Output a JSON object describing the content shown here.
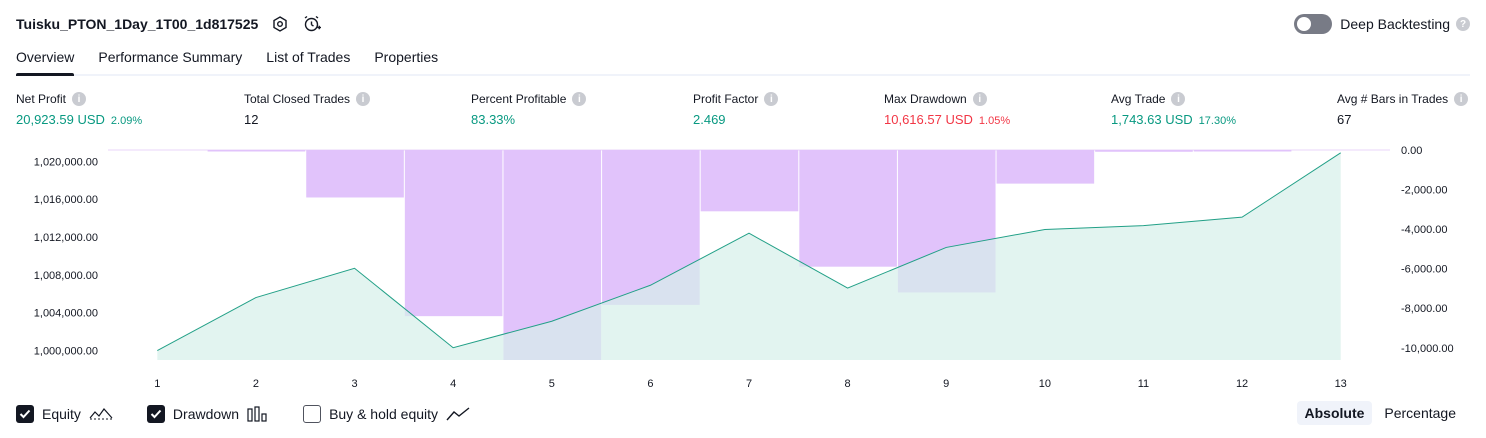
{
  "header": {
    "title": "Tuisku_PTON_1Day_1T00_1d817525",
    "deep_backtesting_label": "Deep Backtesting"
  },
  "tabs": [
    {
      "label": "Overview"
    },
    {
      "label": "Performance Summary"
    },
    {
      "label": "List of Trades"
    },
    {
      "label": "Properties"
    }
  ],
  "metrics": [
    {
      "label": "Net Profit",
      "value": "20,923.59 USD",
      "sub": "2.09%"
    },
    {
      "label": "Total Closed Trades",
      "value": "12",
      "sub": ""
    },
    {
      "label": "Percent Profitable",
      "value": "83.33%",
      "sub": ""
    },
    {
      "label": "Profit Factor",
      "value": "2.469",
      "sub": ""
    },
    {
      "label": "Max Drawdown",
      "value": "10,616.57 USD",
      "sub": "1.05%"
    },
    {
      "label": "Avg Trade",
      "value": "1,743.63 USD",
      "sub": "17.30%"
    },
    {
      "label": "Avg # Bars in Trades",
      "value": "67",
      "sub": ""
    }
  ],
  "legend": {
    "equity_label": "Equity",
    "drawdown_label": "Drawdown",
    "buy_hold_label": "Buy & hold equity"
  },
  "modes": {
    "absolute_label": "Absolute",
    "percentage_label": "Percentage"
  },
  "colors": {
    "positive": "#089981",
    "negative": "#f23645",
    "drawdown_fill": "#e1c3fb",
    "equity_line": "#22a087",
    "equity_fill": "#d6f0ea"
  },
  "chart_data": {
    "type": "line",
    "categories": [
      "1",
      "2",
      "3",
      "4",
      "5",
      "6",
      "7",
      "8",
      "9",
      "10",
      "11",
      "12",
      "13"
    ],
    "series": [
      {
        "name": "Equity",
        "axis": "left",
        "values": [
          1000000,
          1005600,
          1008700,
          1000300,
          1003100,
          1006900,
          1012400,
          1006600,
          1010900,
          1012800,
          1013200,
          1014100,
          1020900
        ]
      },
      {
        "name": "Drawdown",
        "axis": "right",
        "type": "bar",
        "values": [
          0,
          -30,
          -2400,
          -8400,
          -10616.57,
          -7830,
          -3100,
          -5900,
          -7200,
          -1700,
          -90,
          -70,
          0
        ]
      }
    ],
    "y_left": {
      "min": 999000,
      "max": 1021200,
      "ticks": [
        1000000,
        1004000,
        1008000,
        1012000,
        1016000,
        1020000
      ],
      "tick_labels": [
        "1,000,000.00",
        "1,004,000.00",
        "1,008,000.00",
        "1,012,000.00",
        "1,016,000.00",
        "1,020,000.00"
      ]
    },
    "y_right": {
      "min": -10617,
      "max": 0,
      "ticks": [
        0,
        -2000,
        -4000,
        -6000,
        -8000,
        -10000
      ],
      "tick_labels": [
        "0.00",
        "-2,000.00",
        "-4,000.00",
        "-6,000.00",
        "-8,000.00",
        "-10,000.00"
      ]
    },
    "grid": false
  }
}
